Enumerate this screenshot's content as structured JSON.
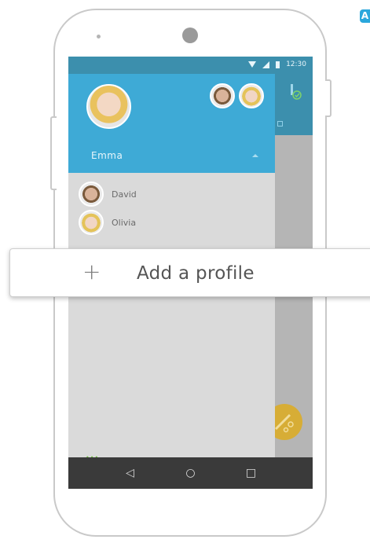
{
  "device": {
    "corner_badge": "A"
  },
  "status_bar": {
    "time": "12:30"
  },
  "drawer": {
    "active_profile": "Emma",
    "profiles": [
      {
        "name": "David"
      },
      {
        "name": "Olivia"
      }
    ]
  },
  "callout": {
    "plus": "+",
    "label": "Add a profile"
  },
  "nav": {
    "back": "◁",
    "home": "○",
    "recents": "□"
  },
  "colors": {
    "header": "#3eaad6",
    "status_bar": "#3c8fad",
    "fab": "#d7ad36",
    "nav_bar": "#3a3a3a"
  },
  "icons": [
    "wifi-icon",
    "signal-icon",
    "battery-icon",
    "toothbrush-icon",
    "check-icon",
    "caret-up-icon",
    "back-icon",
    "home-icon",
    "recents-icon",
    "plus-icon"
  ]
}
